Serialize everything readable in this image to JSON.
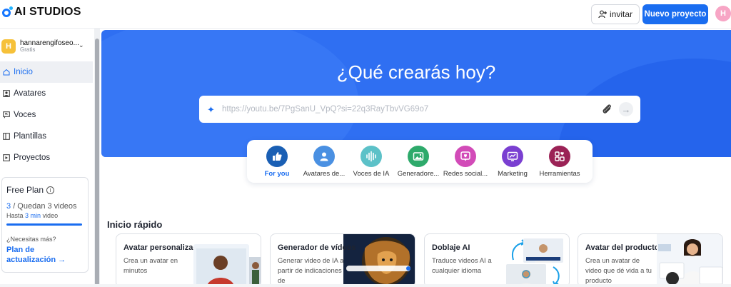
{
  "brand": {
    "name": "AI STUDIOS"
  },
  "header": {
    "invite_label": "invitar",
    "new_project_label": "Nuevo proyecto",
    "user_initial": "H"
  },
  "sidebar": {
    "workspace": {
      "initial": "H",
      "name": "hannarengifoseo...",
      "plan": "Gratis"
    },
    "items": [
      {
        "label": "Inicio",
        "icon": "home-icon",
        "active": true
      },
      {
        "label": "Avatares",
        "icon": "avatar-icon"
      },
      {
        "label": "Voces",
        "icon": "voice-icon"
      },
      {
        "label": "Plantillas",
        "icon": "template-icon"
      },
      {
        "label": "Proyectos",
        "icon": "project-icon"
      }
    ],
    "plan_card": {
      "title": "Free Plan",
      "used": "3",
      "remaining_text": "/ Quedan 3 videos",
      "limit_prefix": "Hasta",
      "limit_value": "3 min",
      "limit_suffix": "video",
      "question": "¿Necesitas más?",
      "upgrade_line1": "Plan de",
      "upgrade_line2": "actualización →"
    }
  },
  "hero": {
    "title": "¿Qué crearás hoy?",
    "search_value": "",
    "search_placeholder": "https://youtu.be/7PgSanU_VpQ?si=22q3RayTbvVG69o7"
  },
  "categories": [
    {
      "label": "For you",
      "color": "#1a5fb4",
      "icon": "thumbs-up-icon",
      "active": true
    },
    {
      "label": "Avatares de...",
      "color": "#4a90e2",
      "icon": "person-icon"
    },
    {
      "label": "Voces de IA",
      "color": "#5cc1c8",
      "icon": "waveform-icon"
    },
    {
      "label": "Generadore...",
      "color": "#2eaa6b",
      "icon": "image-gen-icon"
    },
    {
      "label": "Redes social...",
      "color": "#d24bb8",
      "icon": "social-icon"
    },
    {
      "label": "Marketing",
      "color": "#7a3fd1",
      "icon": "marketing-icon"
    },
    {
      "label": "Herramientas",
      "color": "#9b2256",
      "icon": "tools-icon"
    }
  ],
  "quick_start": {
    "title": "Inicio rápido",
    "cards": [
      {
        "title": "Avatar personalizado",
        "description": "Crea un avatar en minutos"
      },
      {
        "title": "Generador de vídeos",
        "description": "Generar video de IA a partir de indicaciones de"
      },
      {
        "title": "Doblaje AI",
        "description": "Traduce videos AI a cualquier idioma"
      },
      {
        "title": "Avatar del producto",
        "description": "Crea un avatar de video que dé vida a tu producto"
      }
    ]
  }
}
